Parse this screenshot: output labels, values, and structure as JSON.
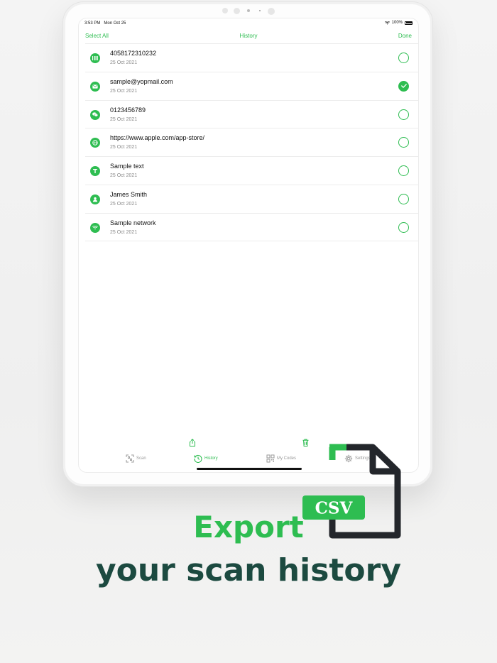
{
  "status": {
    "time": "3:53 PM",
    "date": "Mon Oct 25",
    "battery": "100%"
  },
  "navbar": {
    "left": "Select All",
    "title": "History",
    "right": "Done"
  },
  "items": [
    {
      "icon": "barcode-icon",
      "title": "4058172310232",
      "date": "25 Oct 2021",
      "selected": false
    },
    {
      "icon": "email-icon",
      "title": "sample@yopmail.com",
      "date": "25 Oct 2021",
      "selected": true
    },
    {
      "icon": "message-icon",
      "title": "0123456789",
      "date": "25 Oct 2021",
      "selected": false
    },
    {
      "icon": "globe-icon",
      "title": "https://www.apple.com/app-store/",
      "date": "25 Oct 2021",
      "selected": false
    },
    {
      "icon": "text-icon",
      "title": "Sample text",
      "date": "25 Oct 2021",
      "selected": false
    },
    {
      "icon": "contact-icon",
      "title": "James Smith",
      "date": "25 Oct 2021",
      "selected": false
    },
    {
      "icon": "wifi-icon",
      "title": "Sample network",
      "date": "25 Oct 2021",
      "selected": false
    }
  ],
  "toolbar": {
    "share_icon": "share-icon",
    "delete_icon": "trash-icon"
  },
  "tabs": [
    {
      "label": "Scan",
      "icon": "scan-icon",
      "active": false
    },
    {
      "label": "History",
      "icon": "history-icon",
      "active": true
    },
    {
      "label": "My Codes",
      "icon": "qr-code-icon",
      "active": false
    },
    {
      "label": "Settings",
      "icon": "gear-icon",
      "active": false
    }
  ],
  "promo": {
    "line1": "Export",
    "line2": "your scan history",
    "badge": "CSV"
  },
  "colors": {
    "accent": "#2ebd51",
    "dark_text": "#1c4a40",
    "file_icon": "#23262b"
  }
}
